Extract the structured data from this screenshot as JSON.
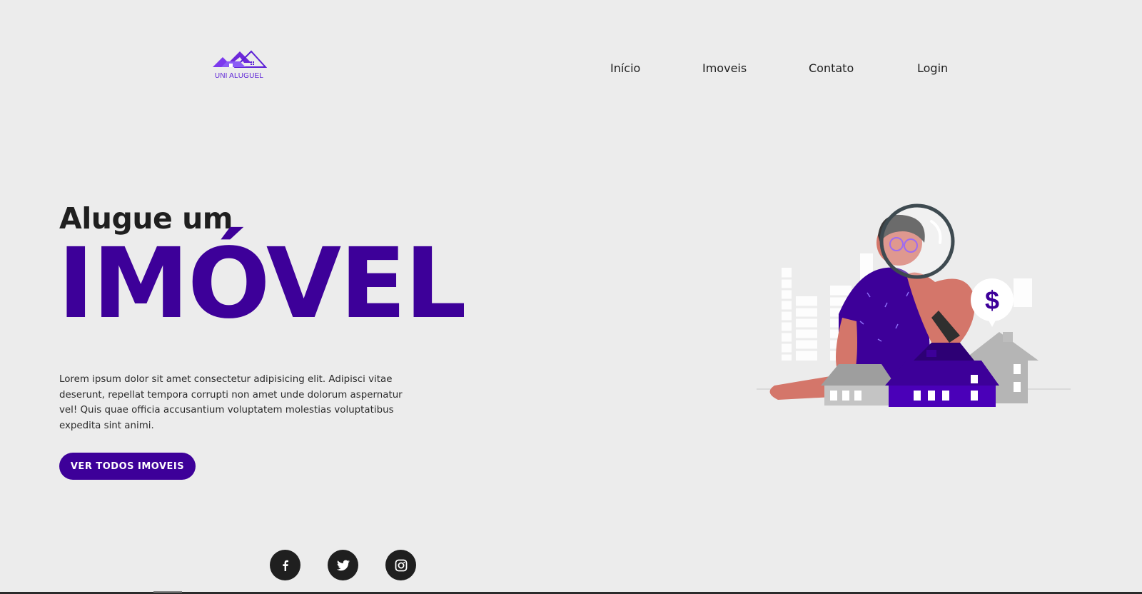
{
  "logo": {
    "text": "UNI ALUGUEL",
    "color": "#5b1fd6"
  },
  "nav": {
    "items": [
      {
        "label": "Início"
      },
      {
        "label": "Imoveis"
      },
      {
        "label": "Contato"
      },
      {
        "label": "Login"
      }
    ]
  },
  "hero": {
    "subtitle": "Alugue um",
    "title": "IMÓVEL",
    "description": "Lorem ipsum dolor sit amet consectetur adipisicing elit. Adipisci vitae deserunt, repellat tempora corrupti non amet unde dolorum aspernatur vel! Quis quae officia accusantium voluptatem molestias voluptatibus expedita sint animi.",
    "cta_label": "VER TODOS IMOVEIS"
  },
  "illustration": {
    "badge_symbol": "$"
  },
  "social": [
    {
      "name": "facebook-icon",
      "glyph": "f"
    },
    {
      "name": "twitter-icon"
    },
    {
      "name": "instagram-icon"
    }
  ],
  "colors": {
    "accent": "#3d0099",
    "background": "#ececec",
    "text": "#1e1e1e",
    "skin": "#d4766a",
    "house_gray": "#b5b5b5"
  }
}
